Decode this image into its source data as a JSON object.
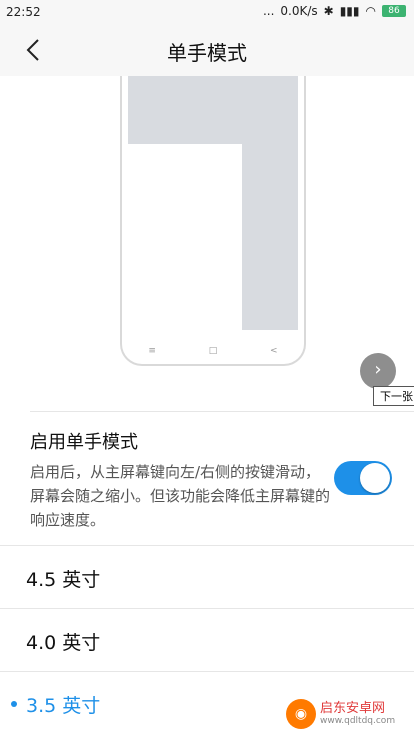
{
  "status": {
    "time": "22:52",
    "dots": "...",
    "speed": "0.0K/s",
    "battery": "86"
  },
  "header": {
    "title": "单手模式",
    "back_icon": "chevron-left-icon"
  },
  "preview": {
    "next_tooltip": "下一张",
    "nav_keys": [
      "≡",
      "□",
      "<"
    ]
  },
  "toggle": {
    "title": "启用单手模式",
    "description": "启用后，从主屏幕键向左/右侧的按键滑动，屏幕会随之缩小。但该功能会降低主屏幕键的响应速度。",
    "enabled": true,
    "color": "#1e90e8"
  },
  "sizes": [
    {
      "label": "4.5 英寸",
      "selected": false
    },
    {
      "label": "4.0 英寸",
      "selected": false
    },
    {
      "label": "3.5 英寸",
      "selected": true
    }
  ],
  "watermark": {
    "name": "启东安卓网",
    "url": "www.qdltdq.com"
  }
}
